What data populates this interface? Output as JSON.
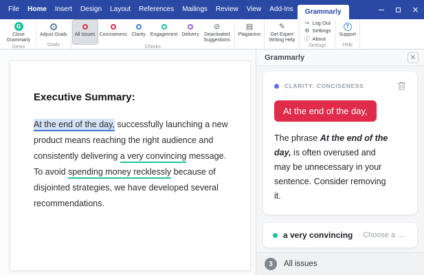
{
  "colors": {
    "titlebar_blue": "#2a49a5",
    "grammarly_green": "#15c39a",
    "suggestion_red": "#e02b4a",
    "clarity_blue": "#5d6cf5",
    "underline_green": "#1fc3a0",
    "highlight_blue_bg": "#d4e3f7",
    "highlight_blue_line": "#4273d3"
  },
  "icons": {
    "window_close": "×",
    "panel_close": "×",
    "grammarly_g": "G",
    "plagiarism": "▤",
    "deactivated": "⊘",
    "expert": "✎",
    "logout": "↪",
    "settings": "⚙",
    "about": "ⓘ",
    "support": "?"
  },
  "titlebar": {
    "menus": [
      "File",
      "Home",
      "Insert",
      "Design",
      "Layout",
      "References",
      "Mailings",
      "Review",
      "View",
      "Add-Ins"
    ],
    "active_tab": "Grammarly"
  },
  "ribbon": {
    "groups": [
      {
        "label": "Demo",
        "buttons": [
          {
            "label": "Close Grammarly"
          }
        ]
      },
      {
        "label": "Goals",
        "buttons": [
          {
            "label": "Adjust Goals"
          }
        ]
      },
      {
        "label": "Checks",
        "buttons": [
          {
            "label": "All Issues",
            "selected": true
          },
          {
            "label": "Conciseness"
          },
          {
            "label": "Clarity"
          },
          {
            "label": "Engagement"
          },
          {
            "label": "Delivery"
          },
          {
            "label": "Deactivated Suggestions"
          }
        ]
      },
      {
        "label": "",
        "buttons": [
          {
            "label": "Plagiarism"
          }
        ]
      },
      {
        "label": "",
        "buttons": [
          {
            "label": "Get Expert Writing Help"
          }
        ]
      },
      {
        "label": "Settings",
        "small_buttons": [
          {
            "label": "Log Out"
          },
          {
            "label": "Settings"
          },
          {
            "label": "About"
          }
        ]
      },
      {
        "label": "Help",
        "buttons": [
          {
            "label": "Support"
          }
        ]
      }
    ]
  },
  "document": {
    "heading": "Executive Summary:",
    "paragraph": {
      "highlight_blue": "At the end of the day,",
      "seg2": " successfully launching a new product means reaching the right audience and consistently delivering ",
      "underline1": "a very convincing",
      "seg4": " message. To avoid ",
      "underline2": "spending money recklessly",
      "seg6": " because of disjointed strategies, we have developed several recommendations."
    }
  },
  "panel": {
    "title": "Grammarly",
    "card": {
      "category": "CLARITY: CONCISENESS",
      "suggestion_button": "At the end of the day,",
      "body": {
        "pre": "The phrase ",
        "emphasis": "At the end of the day,",
        "post": "  is often overused and may be unnecessary in your sentence. Consider removing it."
      }
    },
    "next_card": {
      "text": "a very convincing",
      "separator": "·",
      "action": "Choose a diff..."
    },
    "footer": {
      "count": "3",
      "label": "All issues"
    }
  }
}
